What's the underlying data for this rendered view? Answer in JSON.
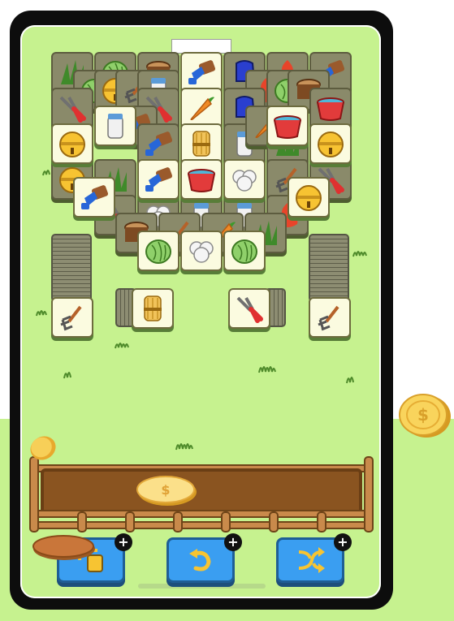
{
  "game": {
    "name": "tile-match-farm",
    "board_tiles": [
      {
        "icon": "grass-icon",
        "state": "blocked"
      },
      {
        "icon": "cabbage-icon",
        "state": "blocked"
      },
      {
        "icon": "log-icon",
        "state": "blocked"
      },
      {
        "icon": "brush-icon",
        "state": "free"
      },
      {
        "icon": "glove-icon",
        "state": "blocked"
      },
      {
        "icon": "fire-icon",
        "state": "blocked"
      },
      {
        "icon": "brush-icon",
        "state": "blocked"
      },
      {
        "icon": "carrot-icon",
        "state": "free"
      },
      {
        "icon": "milk-jar-icon",
        "state": "free"
      },
      {
        "icon": "bucket-icon",
        "state": "free"
      },
      {
        "icon": "bell-icon",
        "state": "free"
      },
      {
        "icon": "wheat-icon",
        "state": "free"
      },
      {
        "icon": "brush-icon",
        "state": "free"
      },
      {
        "icon": "bucket-icon",
        "state": "free"
      },
      {
        "icon": "cotton-icon",
        "state": "free"
      },
      {
        "icon": "bell-icon",
        "state": "free"
      },
      {
        "icon": "brush-icon",
        "state": "free"
      },
      {
        "icon": "cabbage-icon",
        "state": "free"
      },
      {
        "icon": "cotton-icon",
        "state": "free"
      },
      {
        "icon": "cabbage-icon",
        "state": "free"
      },
      {
        "icon": "pitchfork-icon",
        "state": "free"
      },
      {
        "icon": "wheat-icon",
        "state": "free"
      },
      {
        "icon": "shears-icon",
        "state": "free"
      },
      {
        "icon": "pitchfork-icon",
        "state": "free"
      }
    ],
    "tray": {
      "slots_filled": 0
    },
    "buttons": [
      {
        "name": "undo-tile-button",
        "icon": "tile-return-icon",
        "badge": "+"
      },
      {
        "name": "undo-button",
        "icon": "undo-arrow-icon",
        "badge": "+"
      },
      {
        "name": "shuffle-button",
        "icon": "shuffle-icon",
        "badge": "+"
      }
    ]
  },
  "colors": {
    "background": "#c6f28f",
    "tile_face": "#fbfbe0",
    "tile_blocked": "#8a8a6a",
    "button": "#3a9ef1",
    "tray": "#8a5420",
    "coin": "#f6c543"
  }
}
